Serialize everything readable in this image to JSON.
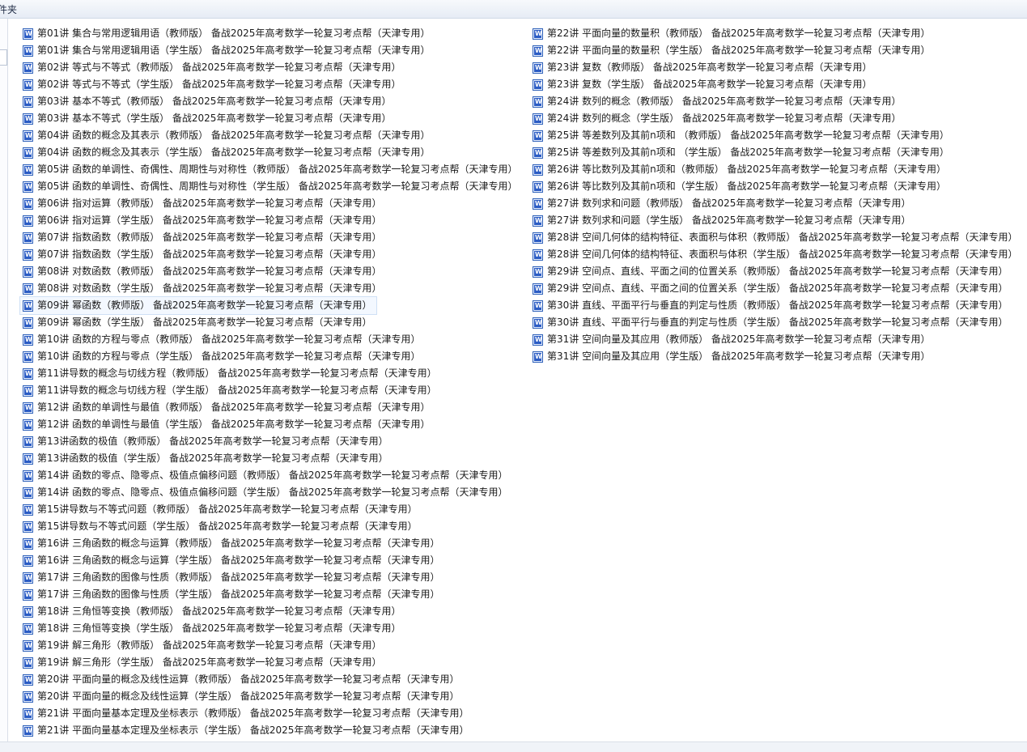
{
  "header": {
    "title": "件夹"
  },
  "icons": {
    "file": "word-document-icon"
  },
  "files_left": [
    "第01讲 集合与常用逻辑用语（教师版） 备战2025年高考数学一轮复习考点帮（天津专用）",
    "第01讲 集合与常用逻辑用语（学生版） 备战2025年高考数学一轮复习考点帮（天津专用）",
    "第02讲 等式与不等式（教师版） 备战2025年高考数学一轮复习考点帮（天津专用）",
    "第02讲 等式与不等式（学生版） 备战2025年高考数学一轮复习考点帮（天津专用）",
    "第03讲 基本不等式（教师版） 备战2025年高考数学一轮复习考点帮（天津专用）",
    "第03讲 基本不等式（学生版） 备战2025年高考数学一轮复习考点帮（天津专用）",
    "第04讲 函数的概念及其表示（教师版） 备战2025年高考数学一轮复习考点帮（天津专用）",
    "第04讲 函数的概念及其表示（学生版） 备战2025年高考数学一轮复习考点帮（天津专用）",
    "第05讲 函数的单调性、奇偶性、周期性与对称性（教师版） 备战2025年高考数学一轮复习考点帮（天津专用）",
    "第05讲 函数的单调性、奇偶性、周期性与对称性（学生版） 备战2025年高考数学一轮复习考点帮（天津专用）",
    "第06讲 指对运算（教师版） 备战2025年高考数学一轮复习考点帮（天津专用）",
    "第06讲 指对运算（学生版） 备战2025年高考数学一轮复习考点帮（天津专用）",
    "第07讲 指数函数（教师版） 备战2025年高考数学一轮复习考点帮（天津专用）",
    "第07讲 指数函数（学生版） 备战2025年高考数学一轮复习考点帮（天津专用）",
    "第08讲 对数函数（教师版） 备战2025年高考数学一轮复习考点帮（天津专用）",
    "第08讲 对数函数（学生版） 备战2025年高考数学一轮复习考点帮（天津专用）",
    "第09讲 幂函数（教师版） 备战2025年高考数学一轮复习考点帮（天津专用）",
    "第09讲 幂函数（学生版） 备战2025年高考数学一轮复习考点帮（天津专用）",
    "第10讲 函数的方程与零点（教师版） 备战2025年高考数学一轮复习考点帮（天津专用）",
    "第10讲 函数的方程与零点（学生版） 备战2025年高考数学一轮复习考点帮（天津专用）",
    "第11讲导数的概念与切线方程（教师版） 备战2025年高考数学一轮复习考点帮（天津专用）",
    "第11讲导数的概念与切线方程（学生版） 备战2025年高考数学一轮复习考点帮（天津专用）",
    "第12讲 函数的单调性与最值（教师版） 备战2025年高考数学一轮复习考点帮（天津专用）",
    "第12讲 函数的单调性与最值（学生版） 备战2025年高考数学一轮复习考点帮（天津专用）",
    "第13讲函数的极值（教师版） 备战2025年高考数学一轮复习考点帮（天津专用）",
    "第13讲函数的极值（学生版） 备战2025年高考数学一轮复习考点帮（天津专用）",
    "第14讲 函数的零点、隐零点、极值点偏移问题（教师版） 备战2025年高考数学一轮复习考点帮（天津专用）",
    "第14讲 函数的零点、隐零点、极值点偏移问题（学生版） 备战2025年高考数学一轮复习考点帮（天津专用）",
    "第15讲导数与不等式问题（教师版） 备战2025年高考数学一轮复习考点帮（天津专用）",
    "第15讲导数与不等式问题（学生版） 备战2025年高考数学一轮复习考点帮（天津专用）",
    "第16讲 三角函数的概念与运算（教师版） 备战2025年高考数学一轮复习考点帮（天津专用）",
    "第16讲 三角函数的概念与运算（学生版） 备战2025年高考数学一轮复习考点帮（天津专用）",
    "第17讲 三角函数的图像与性质（教师版） 备战2025年高考数学一轮复习考点帮（天津专用）",
    "第17讲 三角函数的图像与性质（学生版） 备战2025年高考数学一轮复习考点帮（天津专用）",
    "第18讲 三角恒等变换（教师版） 备战2025年高考数学一轮复习考点帮（天津专用）",
    "第18讲 三角恒等变换（学生版） 备战2025年高考数学一轮复习考点帮（天津专用）",
    "第19讲 解三角形（教师版） 备战2025年高考数学一轮复习考点帮（天津专用）",
    "第19讲 解三角形（学生版） 备战2025年高考数学一轮复习考点帮（天津专用）",
    "第20讲 平面向量的概念及线性运算（教师版） 备战2025年高考数学一轮复习考点帮（天津专用）",
    "第20讲 平面向量的概念及线性运算（学生版） 备战2025年高考数学一轮复习考点帮（天津专用）",
    "第21讲 平面向量基本定理及坐标表示（教师版） 备战2025年高考数学一轮复习考点帮（天津专用）",
    "第21讲 平面向量基本定理及坐标表示（学生版） 备战2025年高考数学一轮复习考点帮（天津专用）"
  ],
  "files_right": [
    "第22讲 平面向量的数量积（教师版） 备战2025年高考数学一轮复习考点帮（天津专用）",
    "第22讲 平面向量的数量积（学生版） 备战2025年高考数学一轮复习考点帮（天津专用）",
    "第23讲 复数（教师版） 备战2025年高考数学一轮复习考点帮（天津专用）",
    "第23讲 复数（学生版） 备战2025年高考数学一轮复习考点帮（天津专用）",
    "第24讲 数列的概念（教师版） 备战2025年高考数学一轮复习考点帮（天津专用）",
    "第24讲 数列的概念（学生版） 备战2025年高考数学一轮复习考点帮（天津专用）",
    "第25讲 等差数列及其前n项和 （教师版） 备战2025年高考数学一轮复习考点帮（天津专用）",
    "第25讲 等差数列及其前n项和 （学生版） 备战2025年高考数学一轮复习考点帮（天津专用）",
    "第26讲 等比数列及其前n项和（教师版） 备战2025年高考数学一轮复习考点帮（天津专用）",
    "第26讲 等比数列及其前n项和（学生版） 备战2025年高考数学一轮复习考点帮（天津专用）",
    "第27讲 数列求和问题（教师版） 备战2025年高考数学一轮复习考点帮（天津专用）",
    "第27讲 数列求和问题（学生版） 备战2025年高考数学一轮复习考点帮（天津专用）",
    "第28讲 空间几何体的结构特征、表面积与体积（教师版） 备战2025年高考数学一轮复习考点帮（天津专用）",
    "第28讲 空间几何体的结构特征、表面积与体积（学生版） 备战2025年高考数学一轮复习考点帮（天津专用）",
    "第29讲 空间点、直线、平面之间的位置关系（教师版） 备战2025年高考数学一轮复习考点帮（天津专用）",
    "第29讲 空间点、直线、平面之间的位置关系（学生版） 备战2025年高考数学一轮复习考点帮（天津专用）",
    "第30讲 直线、平面平行与垂直的判定与性质（教师版） 备战2025年高考数学一轮复习考点帮（天津专用）",
    "第30讲 直线、平面平行与垂直的判定与性质（学生版） 备战2025年高考数学一轮复习考点帮（天津专用）",
    "第31讲 空间向量及其应用（教师版） 备战2025年高考数学一轮复习考点帮（天津专用）",
    "第31讲 空间向量及其应用（学生版） 备战2025年高考数学一轮复习考点帮（天津专用）"
  ],
  "selected_left_index": 16
}
